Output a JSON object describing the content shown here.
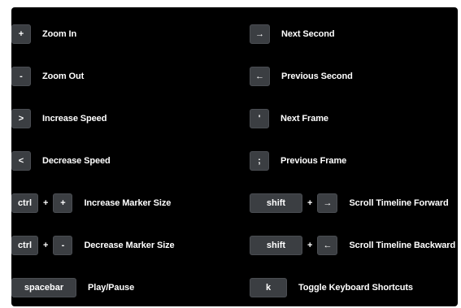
{
  "shortcuts": {
    "left": [
      {
        "keys": [
          "+"
        ],
        "label": "Zoom In"
      },
      {
        "keys": [
          "-"
        ],
        "label": "Zoom Out"
      },
      {
        "keys": [
          ">"
        ],
        "label": "Increase Speed"
      },
      {
        "keys": [
          "<"
        ],
        "label": "Decrease Speed"
      },
      {
        "keys": [
          "ctrl",
          "+"
        ],
        "label": "Increase Marker Size"
      },
      {
        "keys": [
          "ctrl",
          "-"
        ],
        "label": "Decrease Marker Size"
      },
      {
        "keys": [
          "spacebar"
        ],
        "label": "Play/Pause"
      }
    ],
    "right": [
      {
        "keys": [
          "→"
        ],
        "label": "Next Second"
      },
      {
        "keys": [
          "←"
        ],
        "label": "Previous Second"
      },
      {
        "keys": [
          "'"
        ],
        "label": "Next Frame"
      },
      {
        "keys": [
          ";"
        ],
        "label": "Previous Frame"
      },
      {
        "keys": [
          "shift",
          "→"
        ],
        "label": "Scroll Timeline Forward"
      },
      {
        "keys": [
          "shift",
          "←"
        ],
        "label": "Scroll Timeline Backward"
      },
      {
        "keys": [
          "k"
        ],
        "label": "Toggle Keyboard Shortcuts"
      }
    ]
  },
  "combo_separator": "+",
  "colors": {
    "panel_background": "#000000",
    "key_background": "#3b3e42",
    "text": "#ffffff"
  }
}
